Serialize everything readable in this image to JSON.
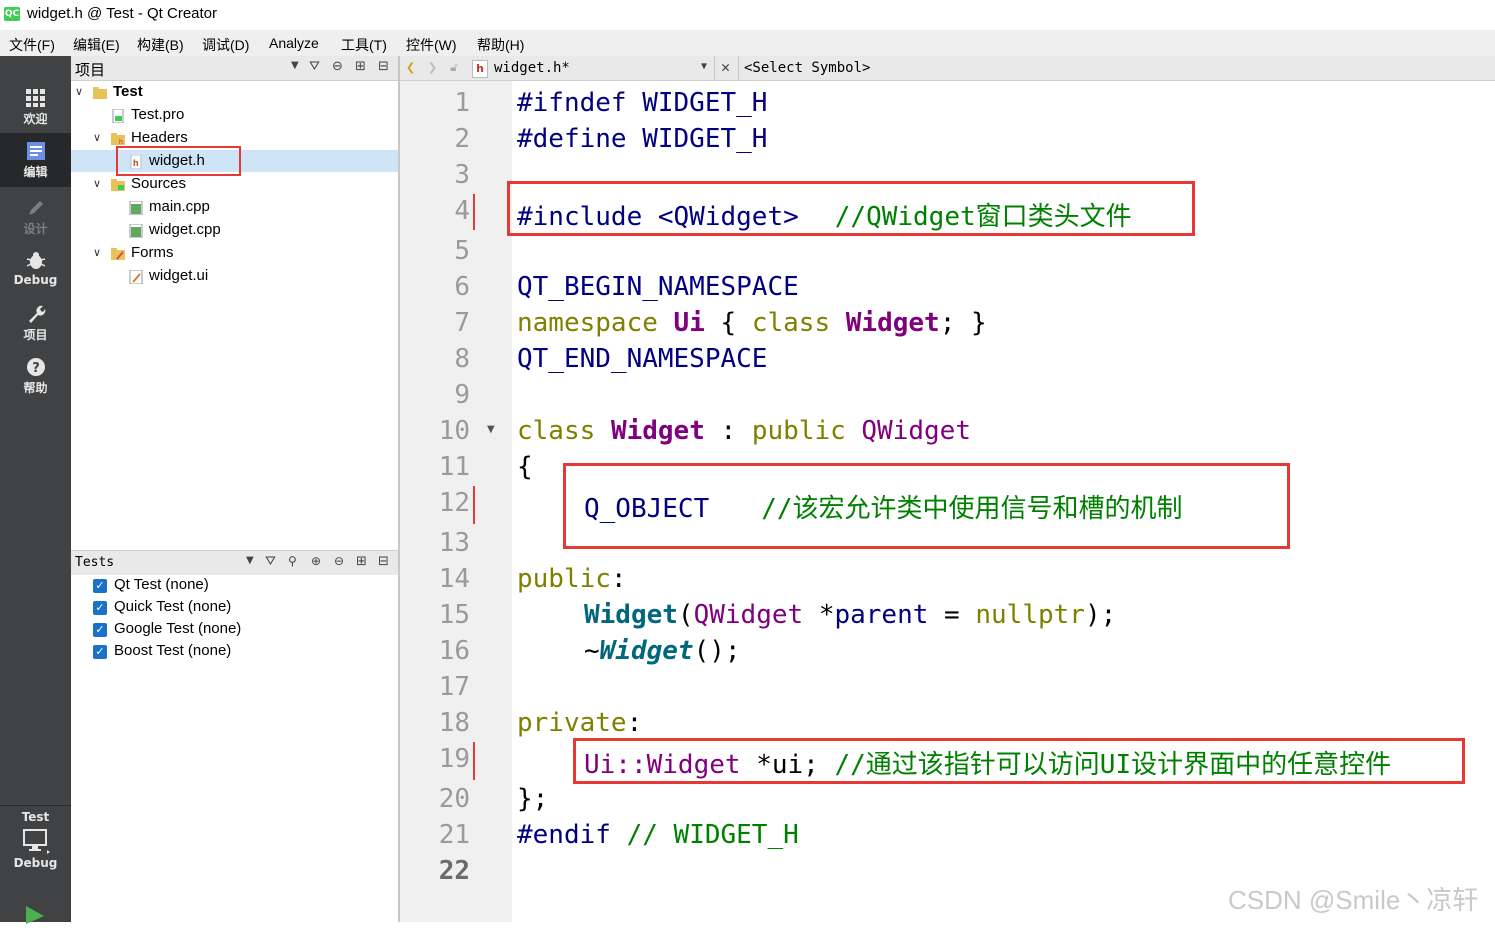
{
  "window": {
    "title": "widget.h @ Test - Qt Creator",
    "app_icon": "QC"
  },
  "menubar": [
    "文件(F)",
    "编辑(E)",
    "构建(B)",
    "调试(D)",
    "Analyze",
    "工具(T)",
    "控件(W)",
    "帮助(H)"
  ],
  "modebar": {
    "modes": [
      "欢迎",
      "编辑",
      "设计",
      "Debug",
      "项目",
      "帮助"
    ],
    "target_project": "Test",
    "target_config": "Debug"
  },
  "project_panel": {
    "title": "项目",
    "tree": {
      "root": "Test",
      "pro_file": "Test.pro",
      "headers": "Headers",
      "header_file": "widget.h",
      "sources": "Sources",
      "source_main": "main.cpp",
      "source_widget": "widget.cpp",
      "forms": "Forms",
      "form_file": "widget.ui"
    }
  },
  "tests_panel": {
    "title": "Tests",
    "items": [
      "Qt Test (none)",
      "Quick Test (none)",
      "Google Test (none)",
      "Boost Test (none)"
    ]
  },
  "editor": {
    "file_tab": "widget.h*",
    "symbol": "<Select Symbol>",
    "line_numbers": [
      "1",
      "2",
      "3",
      "4",
      "5",
      "6",
      "7",
      "8",
      "9",
      "10",
      "11",
      "12",
      "13",
      "14",
      "15",
      "16",
      "17",
      "18",
      "19",
      "20",
      "21",
      "22"
    ],
    "code": {
      "l1": "#ifndef WIDGET_H",
      "l2": "#define WIDGET_H",
      "l4_a": "#include <QWidget>",
      "l4_c": "//QWidget窗口类头文件",
      "l6": "QT_BEGIN_NAMESPACE",
      "l7_a": "namespace",
      "l7_b": "Ui",
      "l7_c": "{",
      "l7_d": "class",
      "l7_e": "Widget",
      "l7_f": "; }",
      "l8": "QT_END_NAMESPACE",
      "l10_a": "class",
      "l10_b": "Widget",
      "l10_c": ":",
      "l10_d": "public",
      "l10_e": "QWidget",
      "l11": "{",
      "l12_a": "Q_OBJECT",
      "l12_c": "//该宏允许类中使用信号和槽的机制",
      "l14_a": "public",
      "l14_b": ":",
      "l15_a": "Widget",
      "l15_b": "(",
      "l15_c": "QWidget",
      "l15_d": "*",
      "l15_e": "parent",
      "l15_f": "=",
      "l15_g": "nullptr",
      "l15_h": ");",
      "l16_a": "~",
      "l16_b": "Widget",
      "l16_c": "();",
      "l18_a": "private",
      "l18_b": ":",
      "l19_a": "Ui::Widget",
      "l19_b": "*ui;",
      "l19_c": "//通过该指针可以访问UI设计界面中的任意控件",
      "l20": "};",
      "l21_a": "#endif",
      "l21_b": "// WIDGET_H"
    }
  },
  "watermark": "CSDN @Smile丶凉轩"
}
